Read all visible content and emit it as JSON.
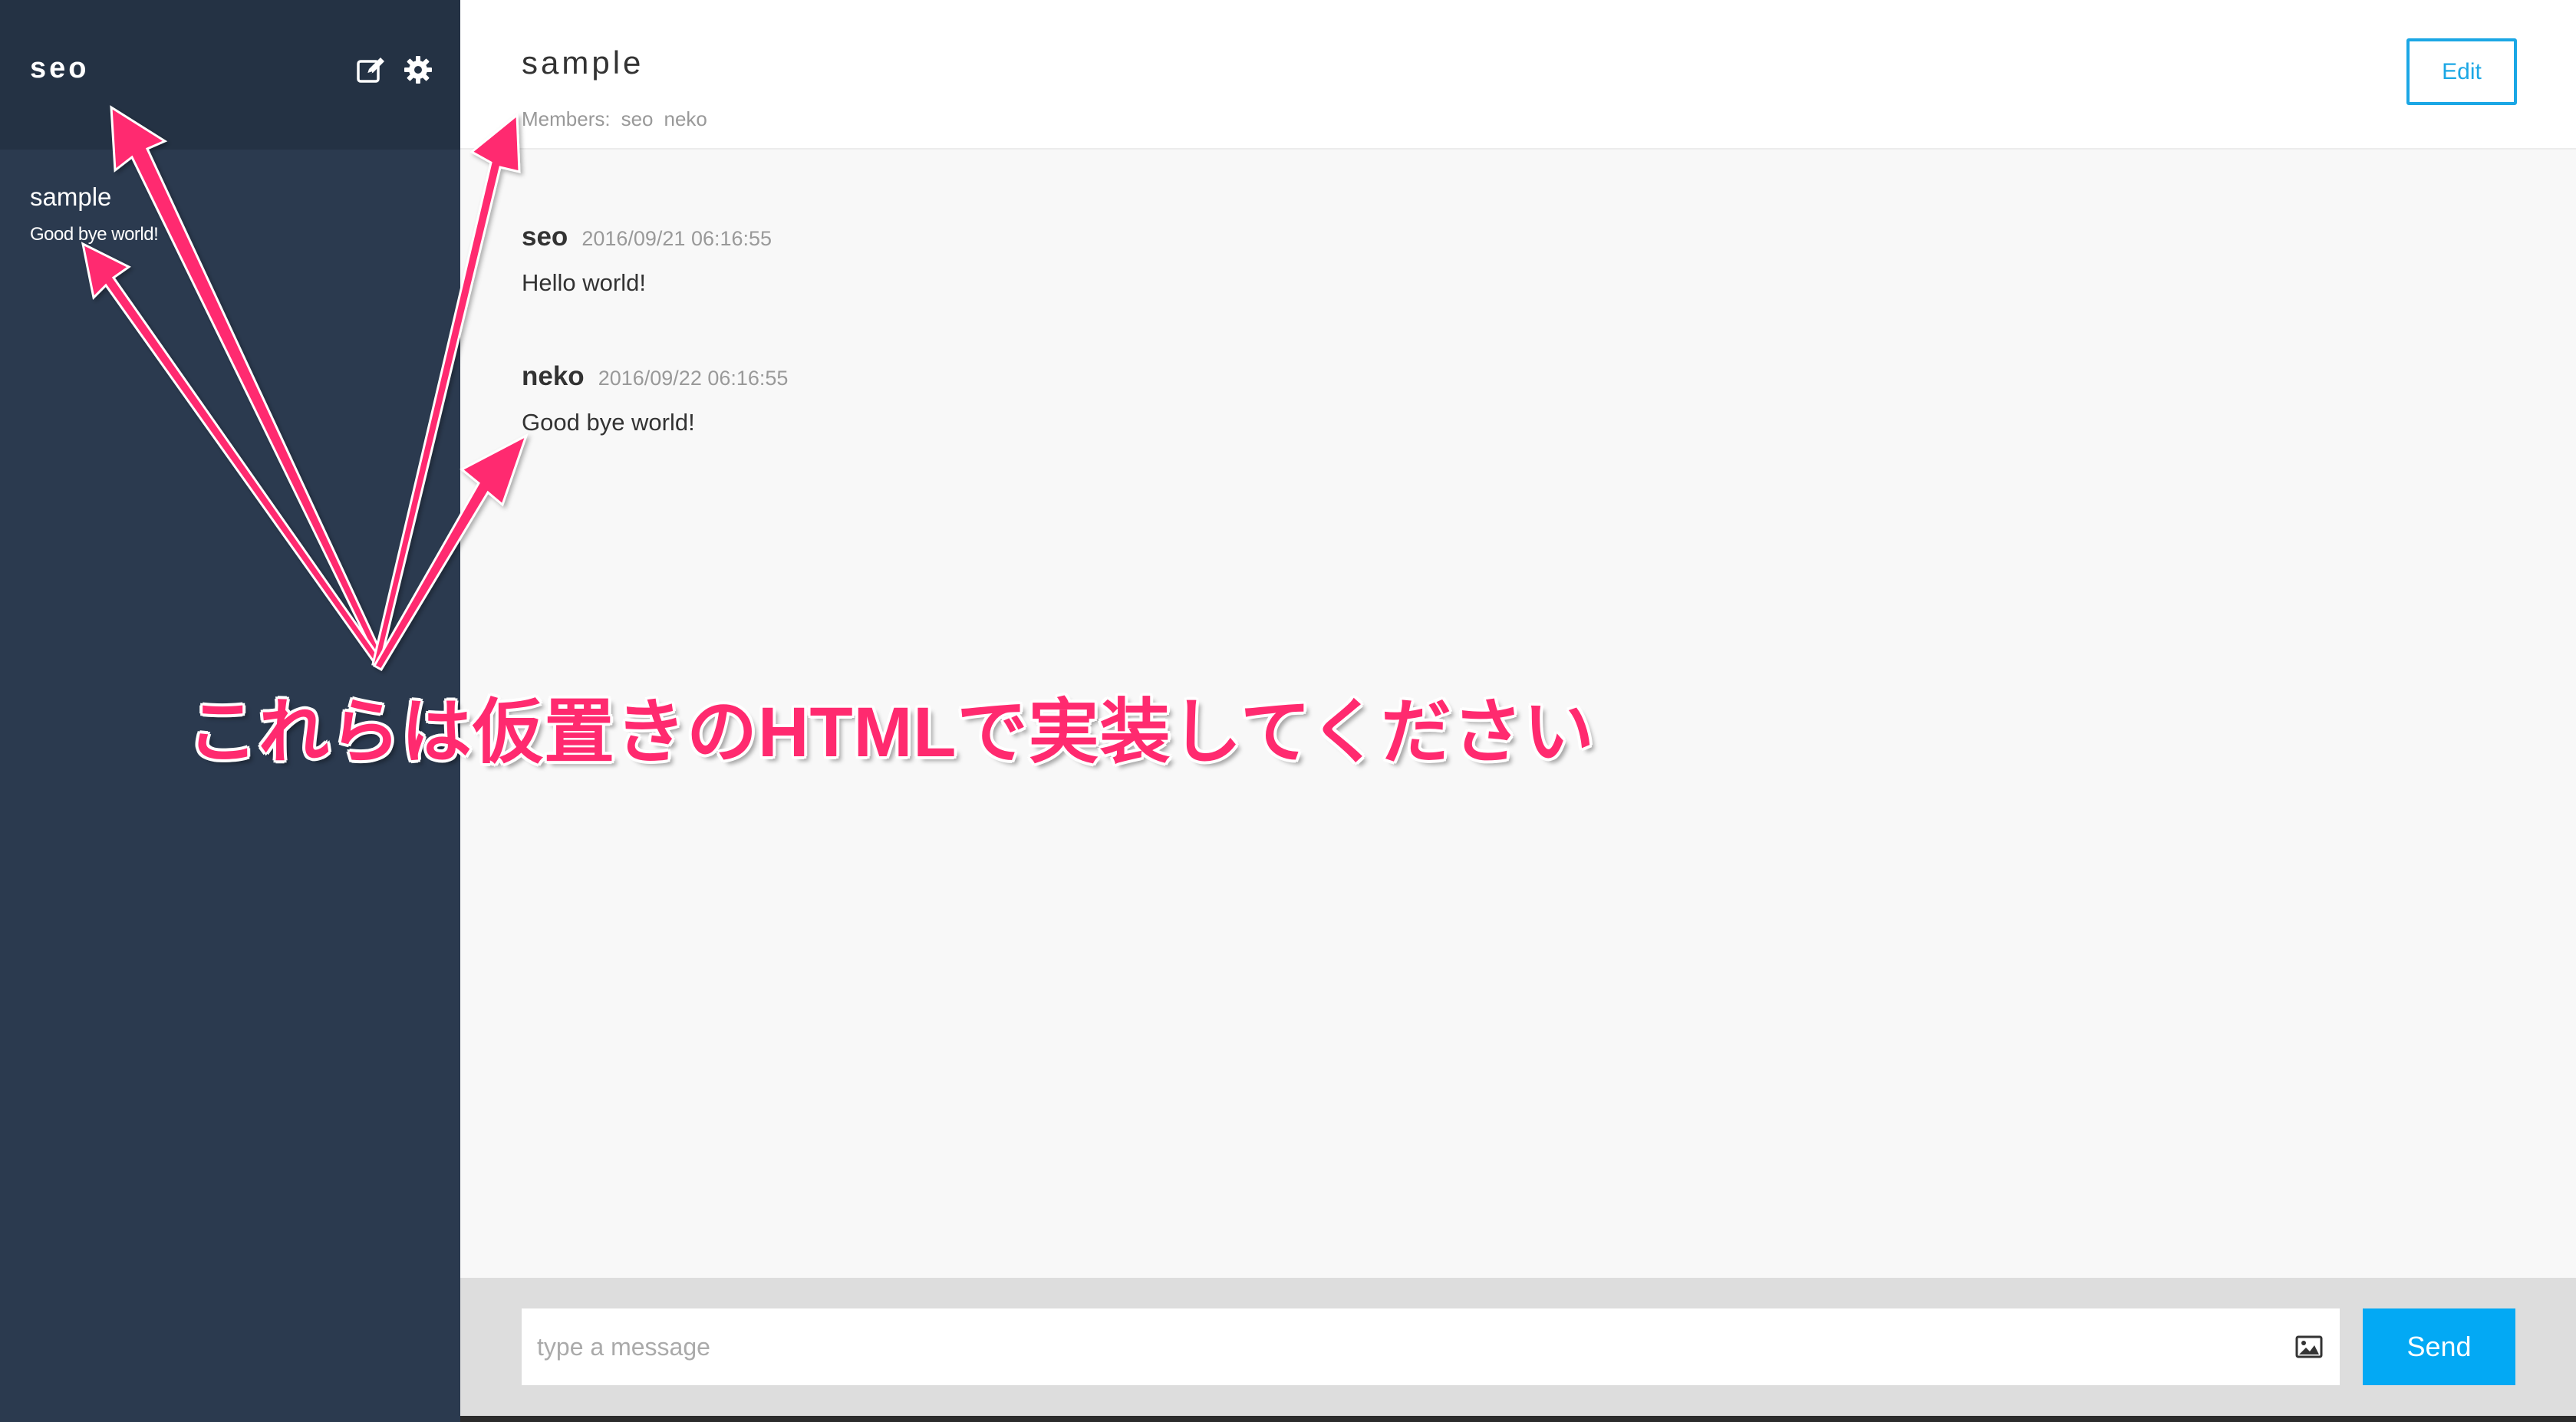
{
  "sidebar": {
    "user_name": "seo",
    "icons": [
      "compose-icon",
      "gear-icon"
    ],
    "rooms": [
      {
        "name": "sample",
        "last_message": "Good bye world!"
      }
    ]
  },
  "room": {
    "title": "sample",
    "members_label": "Members:",
    "members": [
      "seo",
      "neko"
    ],
    "edit_label": "Edit"
  },
  "messages": [
    {
      "author": "seo",
      "time": "2016/09/21 06:16:55",
      "text": "Hello world!"
    },
    {
      "author": "neko",
      "time": "2016/09/22 06:16:55",
      "text": "Good bye world!"
    }
  ],
  "composer": {
    "placeholder": "type a message",
    "value": "",
    "attach_icon": "image-icon",
    "send_label": "Send"
  },
  "annotation": {
    "text": "これらは仮置きのHTMLで実装してください",
    "color": "#ff2a6f"
  },
  "colors": {
    "sidebar_bg": "#2b3a4f",
    "sidebar_header_bg": "#243244",
    "accent": "#03a9f4",
    "edit_border": "#1ba7e5"
  }
}
